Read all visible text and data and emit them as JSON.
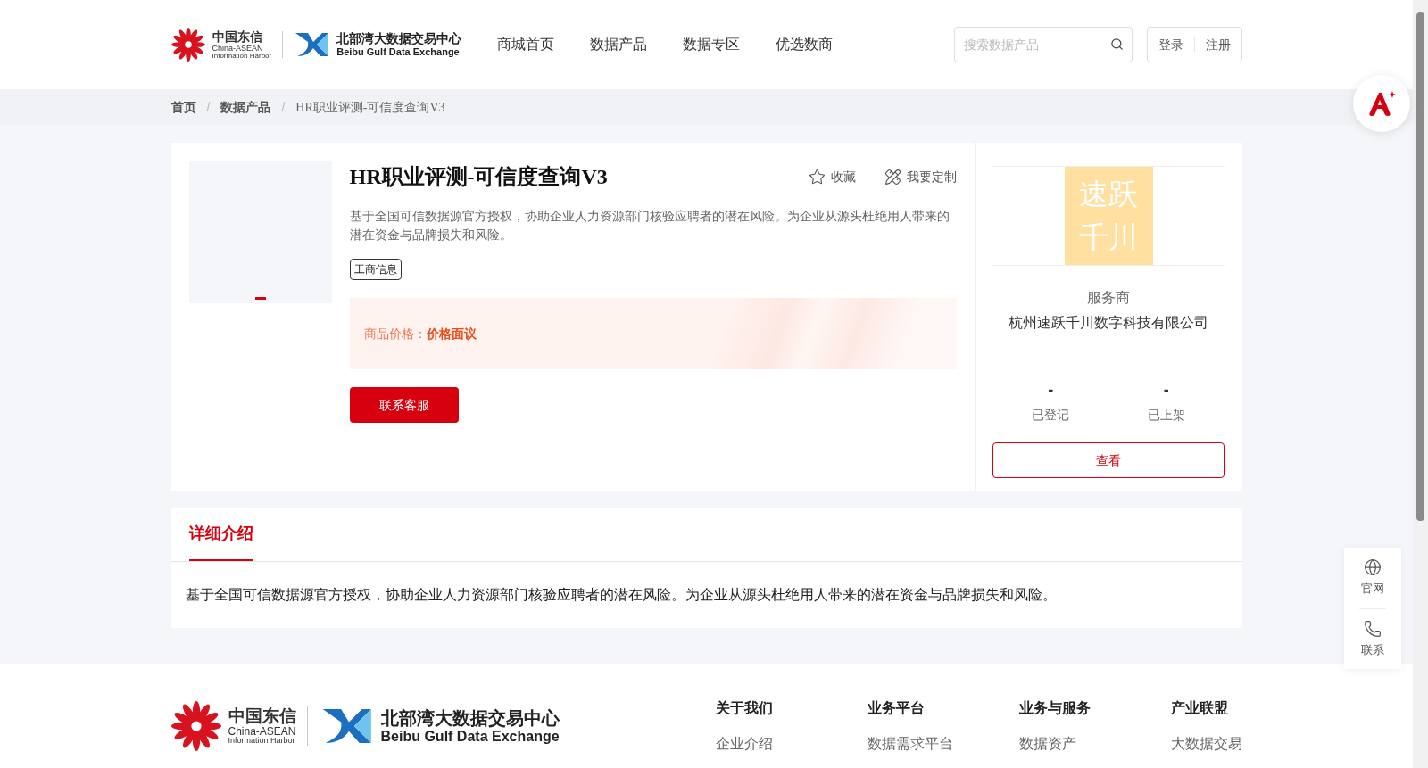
{
  "header": {
    "logo_cn": "中国东信",
    "logo_en1": "China-ASEAN",
    "logo_en2": "Information Harbor",
    "logo2_cn": "北部湾大数据交易中心",
    "logo2_en": "Beibu Gulf Data Exchange",
    "nav": [
      {
        "label": "商城首页",
        "selected": false
      },
      {
        "label": "数据产品",
        "selected": false
      },
      {
        "label": "数据专区",
        "selected": false
      },
      {
        "label": "优选数商",
        "selected": false
      }
    ],
    "search": {
      "placeholder": "搜索数据产品"
    },
    "login": "登录",
    "register": "注册"
  },
  "breadcrumb": {
    "items": [
      "首页",
      "数据产品",
      "HR职业评测-可信度查询V3"
    ],
    "separators": [
      "/",
      "/"
    ]
  },
  "product": {
    "title": "HR职业评测-可信度查询V3",
    "favorite": "收藏",
    "customize": "我要定制",
    "description": "基于全国可信数据源官方授权，协助企业人力资源部门核验应聘者的潜在风险。为企业从源头杜绝用人带来的潜在资金与品牌损失和风险。",
    "tags": [
      "工商信息"
    ],
    "price_label": "商品价格：",
    "price": "价格面议",
    "contact_button": "联系客服"
  },
  "provider": {
    "logo_line1": "速跃",
    "logo_line2": "千川",
    "label": "服务商",
    "name": "杭州速跃千川数字科技有限公司",
    "stats": [
      {
        "value": "-",
        "label": "已登记"
      },
      {
        "value": "-",
        "label": "已上架"
      }
    ],
    "view_button": "查看"
  },
  "details": {
    "tabs": [
      {
        "label": "详细介绍",
        "selected": true
      }
    ],
    "text": "基于全国可信数据源官方授权，协助企业人力资源部门核验应聘者的潜在风险。为企业从源头杜绝用人带来的潜在资金与品牌损失和风险。"
  },
  "side_tools": [
    {
      "kind": "globe",
      "label": "官网"
    },
    {
      "kind": "phone",
      "label": "联系"
    }
  ],
  "footer": {
    "logo": {
      "logo_cn": "中国东信",
      "logo_en1": "China-ASEAN",
      "logo_en2": "Information Harbor",
      "logo2_cn": "北部湾大数据交易中心",
      "logo2_en": "Beibu Gulf Data Exchange"
    },
    "columns": [
      {
        "title": "关于我们",
        "links": [
          "企业介绍"
        ]
      },
      {
        "title": "业务平台",
        "links": [
          "数据需求平台"
        ]
      },
      {
        "title": "业务与服务",
        "links": [
          "数据资产"
        ]
      },
      {
        "title": "产业联盟",
        "links": [
          "大数据交易"
        ]
      }
    ]
  }
}
